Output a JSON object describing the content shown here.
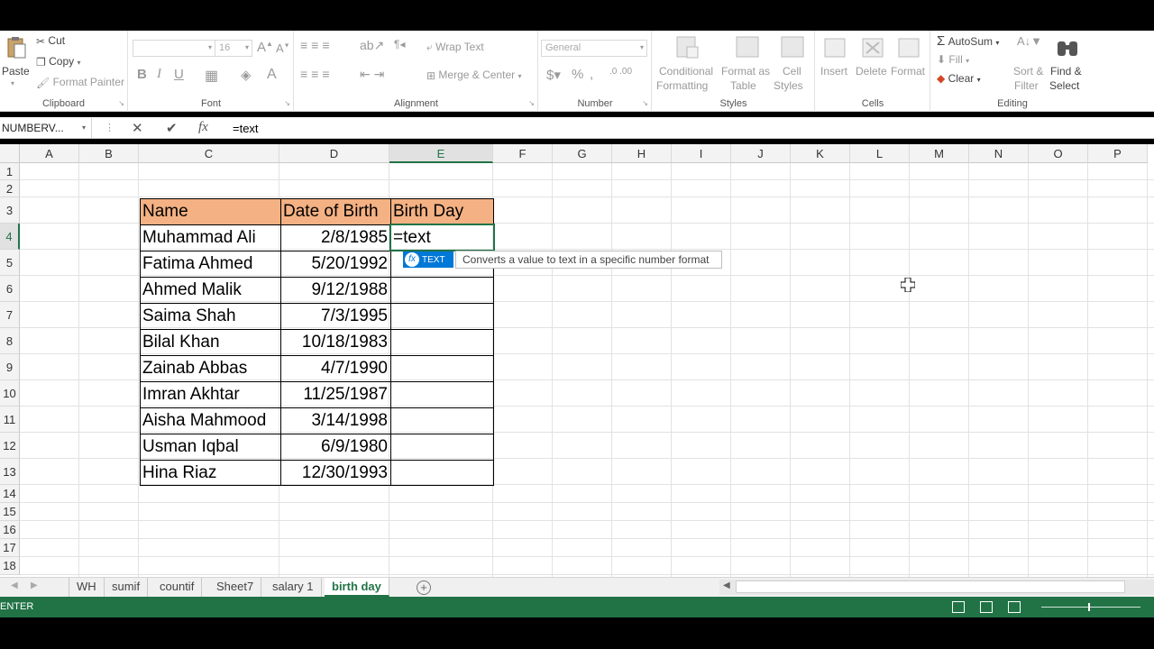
{
  "ribbon": {
    "clipboard": {
      "paste": "Paste",
      "cut": "Cut",
      "copy": "Copy",
      "format_painter": "Format Painter",
      "label": "Clipboard"
    },
    "font": {
      "font_size": "16",
      "bold": "B",
      "italic": "I",
      "underline": "U",
      "label": "Font"
    },
    "alignment": {
      "wrap_text": "Wrap Text",
      "merge_center": "Merge & Center",
      "label": "Alignment"
    },
    "number": {
      "format": "General",
      "label": "Number"
    },
    "styles": {
      "conditional_1": "Conditional",
      "conditional_2": "Formatting",
      "format_as_1": "Format as",
      "format_as_2": "Table",
      "cell_styles_1": "Cell",
      "cell_styles_2": "Styles",
      "label": "Styles"
    },
    "cells": {
      "insert": "Insert",
      "delete": "Delete",
      "format": "Format",
      "label": "Cells"
    },
    "editing": {
      "autosum": "AutoSum",
      "fill": "Fill",
      "clear": "Clear",
      "sort_1": "Sort &",
      "sort_2": "Filter",
      "find_1": "Find &",
      "find_2": "Select",
      "label": "Editing"
    }
  },
  "formula_bar": {
    "name_box": "NUMBERV...",
    "cancel": "✕",
    "enter": "✔",
    "fx": "fx",
    "formula": "=text"
  },
  "columns": [
    "A",
    "B",
    "C",
    "D",
    "E",
    "F",
    "G",
    "H",
    "I",
    "J",
    "K",
    "L",
    "M",
    "N",
    "O",
    "P"
  ],
  "rows": [
    "1",
    "2",
    "3",
    "4",
    "5",
    "6",
    "7",
    "8",
    "9",
    "10",
    "11",
    "12",
    "13",
    "14",
    "15",
    "16",
    "17",
    "18"
  ],
  "table": {
    "headers": [
      "Name",
      "Date of Birth",
      "Birth Day"
    ],
    "rows": [
      {
        "name": "Muhammad Ali",
        "dob": "2/8/1985",
        "day": "=text"
      },
      {
        "name": "Fatima Ahmed",
        "dob": "5/20/1992",
        "day": ""
      },
      {
        "name": "Ahmed Malik",
        "dob": "9/12/1988",
        "day": ""
      },
      {
        "name": "Saima Shah",
        "dob": "7/3/1995",
        "day": ""
      },
      {
        "name": "Bilal Khan",
        "dob": "10/18/1983",
        "day": ""
      },
      {
        "name": "Zainab Abbas",
        "dob": "4/7/1990",
        "day": ""
      },
      {
        "name": "Imran Akhtar",
        "dob": "11/25/1987",
        "day": ""
      },
      {
        "name": "Aisha Mahmood",
        "dob": "3/14/1998",
        "day": ""
      },
      {
        "name": "Usman Iqbal",
        "dob": "6/9/1980",
        "day": ""
      },
      {
        "name": "Hina Riaz",
        "dob": "12/30/1993",
        "day": ""
      }
    ]
  },
  "autocomplete": {
    "function_name": "TEXT",
    "description": "Converts a value to text in a specific number format"
  },
  "sheet_tabs": [
    "WH",
    "sumif",
    "countif",
    "Sheet7",
    "salary 1",
    "birth day"
  ],
  "active_sheet": "birth day",
  "status": {
    "mode": "ENTER"
  },
  "colors": {
    "accent": "#217346",
    "header_fill": "#f4b183",
    "tooltip_tag": "#0078d7"
  }
}
